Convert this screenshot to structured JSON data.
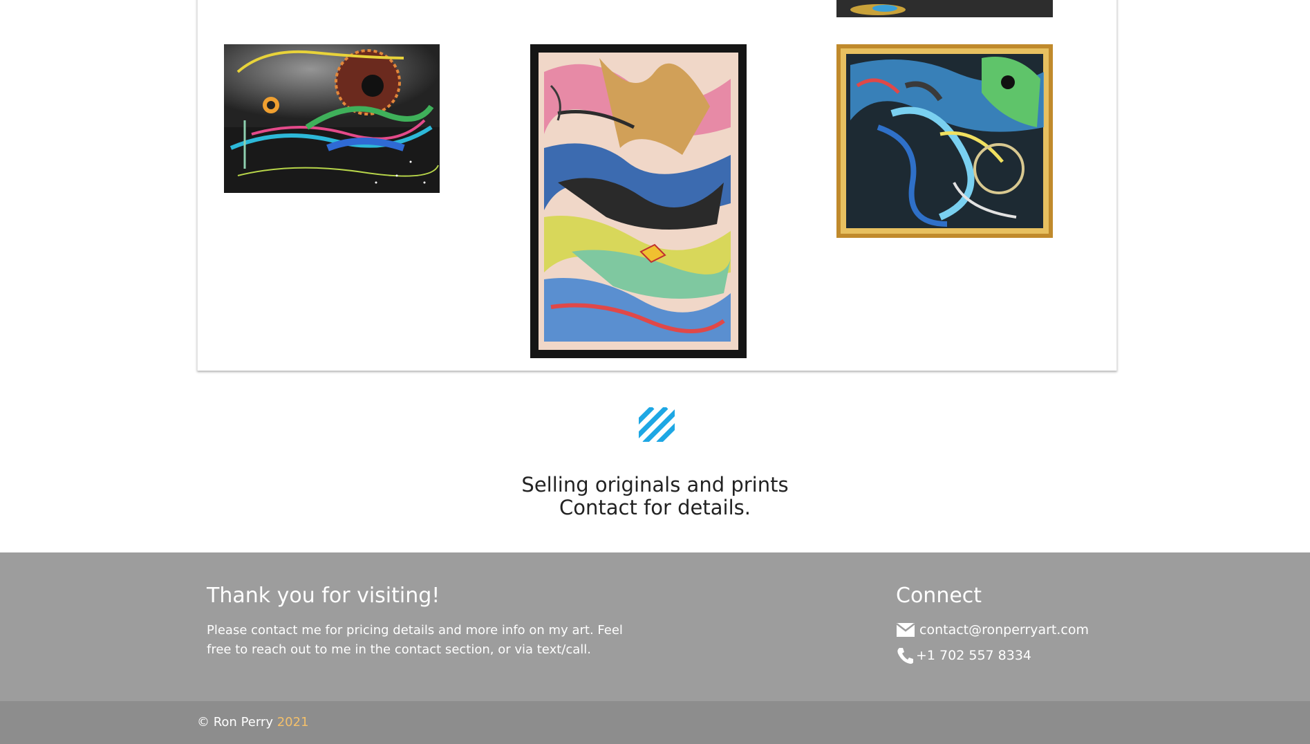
{
  "gallery": {
    "artworks": [
      {
        "name": "abstract-painting-space"
      },
      {
        "name": "abstract-painting-tall"
      },
      {
        "name": "abstract-painting-framed"
      }
    ]
  },
  "divider": {
    "icon": "diagonal-stripes-icon",
    "color": "#1ea7e4"
  },
  "selling": {
    "line1": "Selling originals and prints",
    "line2": "Contact for details."
  },
  "footer": {
    "thanks_title": "Thank you for visiting!",
    "thanks_text": "Please contact me for pricing details and more info on my art. Feel free to reach out to me in the contact section, or via text/call.",
    "connect_title": "Connect",
    "email": "contact@ronperryart.com",
    "phone": "+1 702 557 8334",
    "email_icon": "mail-icon",
    "phone_icon": "phone-icon"
  },
  "copyright": {
    "owner": "© Ron Perry",
    "year": "2021",
    "year_color": "#f4c06a"
  },
  "colors": {
    "footer_bg": "#9d9d9d",
    "bottom_bar_bg": "#8d8d8d"
  }
}
